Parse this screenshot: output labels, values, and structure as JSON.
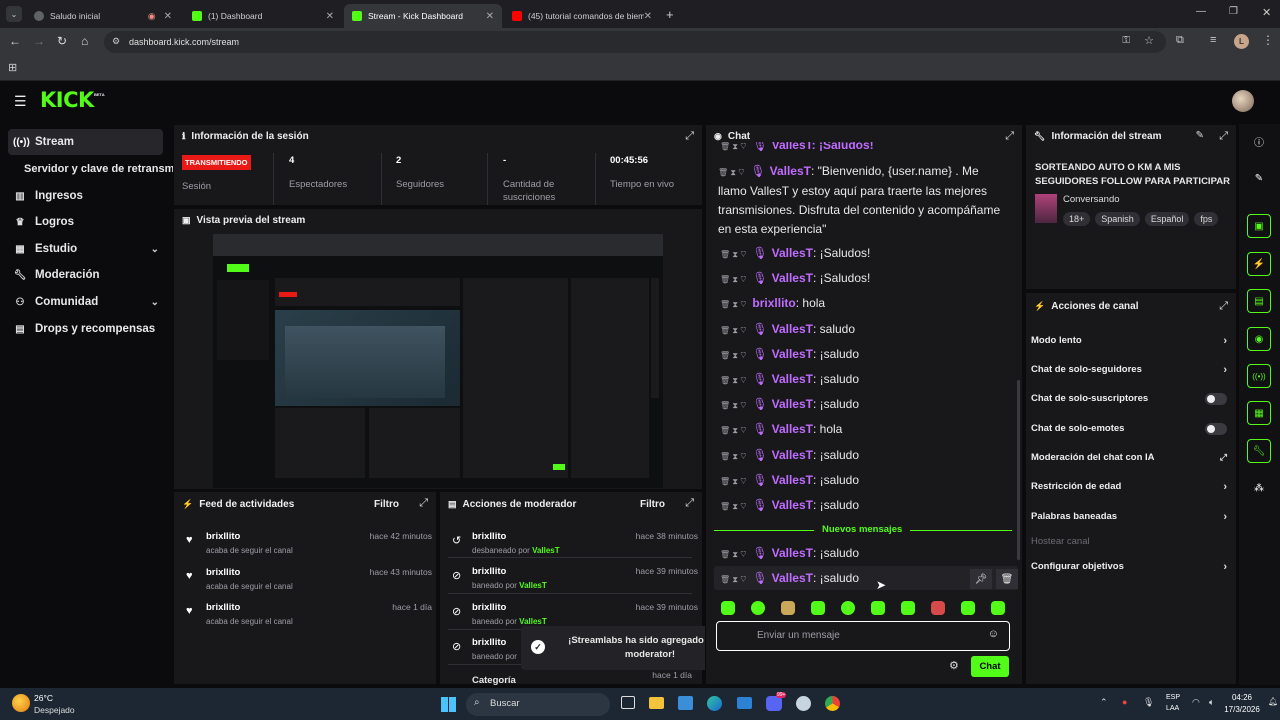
{
  "browser": {
    "tabs": [
      {
        "label": "Saludo inicial"
      },
      {
        "label": "(1) Dashboard"
      },
      {
        "label": "Stream - Kick Dashboard"
      },
      {
        "label": "(45) tutorial comandos de biem..."
      }
    ],
    "url": "dashboard.kick.com/stream",
    "profile_letter": "L"
  },
  "brand": {
    "logo": "KICK",
    "beta": "BETA"
  },
  "sidebar": {
    "items": [
      {
        "label": "Stream"
      },
      {
        "label": "Servidor y clave de retransm"
      },
      {
        "label": "Ingresos"
      },
      {
        "label": "Logros"
      },
      {
        "label": "Estudio"
      },
      {
        "label": "Moderación"
      },
      {
        "label": "Comunidad"
      },
      {
        "label": "Drops y recompensas"
      }
    ]
  },
  "session": {
    "title": "Información de la sesión",
    "status_badge": "TRANSMITIENDO",
    "status_label": "Sesión",
    "stats": [
      {
        "value": "4",
        "label": "Espectadores"
      },
      {
        "value": "2",
        "label": "Seguidores"
      },
      {
        "value": "-",
        "label": "Cantidad de suscriciones"
      },
      {
        "value": "00:45:56",
        "label": "Tiempo en vivo"
      }
    ]
  },
  "preview": {
    "title": "Vista previa del stream"
  },
  "feed": {
    "title": "Feed de actividades",
    "filter": "Filtro",
    "rows": [
      {
        "name": "brixllito",
        "sub": "acaba de seguir el canal",
        "time": "hace 42 minutos"
      },
      {
        "name": "brixllito",
        "sub": "acaba de seguir el canal",
        "time": "hace 43 minutos"
      },
      {
        "name": "brixllito",
        "sub": "acaba de seguir el canal",
        "time": "hace 1 día"
      }
    ]
  },
  "modactions": {
    "title": "Acciones de moderador",
    "filter": "Filtro",
    "rows": [
      {
        "name": "brixllito",
        "sub": "desbaneado por",
        "by": "VallesT",
        "time": "hace 38 minutos"
      },
      {
        "name": "brixllito",
        "sub": "baneado por",
        "by": "VallesT",
        "time": "hace 39 minutos"
      },
      {
        "name": "brixllito",
        "sub": "baneado por",
        "by": "VallesT",
        "time": "hace 39 minutos"
      },
      {
        "name": "brixllito",
        "sub": "baneado por",
        "by": "",
        "time": ""
      }
    ],
    "last_row": {
      "label": "Categoría",
      "time": "hace 1 día"
    }
  },
  "toast": {
    "text": "¡Streamlabs ha sido agregado como moderator!"
  },
  "chat": {
    "title": "Chat",
    "top_partial": "VallesT: ¡Saludos!",
    "welcome": {
      "user": "VallesT",
      "text": ": \"Bienvenido, {user.name} . Me llamo VallesT y estoy aquí para traerte las mejores transmisiones. Disfruta del contenido y acompáñame en esta experiencia\""
    },
    "messages": [
      {
        "user": "VallesT",
        "text": ": ¡Saludos!",
        "color": "#c06cff"
      },
      {
        "user": "VallesT",
        "text": ": ¡Saludos!",
        "color": "#c06cff"
      },
      {
        "user": "brixllito",
        "text": ": hola",
        "color": "#c06cff"
      },
      {
        "user": "VallesT",
        "text": ": saludo",
        "color": "#c06cff"
      },
      {
        "user": "VallesT",
        "text": ": ¡saludo",
        "color": "#c06cff"
      },
      {
        "user": "VallesT",
        "text": ": ¡saludo",
        "color": "#c06cff"
      },
      {
        "user": "VallesT",
        "text": ": ¡saludo",
        "color": "#c06cff"
      },
      {
        "user": "VallesT",
        "text": ": hola",
        "color": "#c06cff"
      },
      {
        "user": "VallesT",
        "text": ": ¡saludo",
        "color": "#c06cff"
      },
      {
        "user": "VallesT",
        "text": ": ¡saludo",
        "color": "#c06cff"
      },
      {
        "user": "VallesT",
        "text": ": ¡saludo",
        "color": "#c06cff"
      }
    ],
    "new_messages": "Nuevos mensajes",
    "after": [
      {
        "user": "VallesT",
        "text": ": ¡saludo"
      },
      {
        "user": "VallesT",
        "text": ": ¡saludo"
      }
    ],
    "input_placeholder": "Enviar un mensaje",
    "send_label": "Chat"
  },
  "streaminfo": {
    "title": "Información del stream",
    "stream_title": "SORTEANDO AUTO O KM A MIS SEGUIDORES FOLLOW PARA PARTICIPAR",
    "category": "Conversando",
    "tags": [
      "18+",
      "Spanish",
      "Español",
      "fps"
    ]
  },
  "channel_actions": {
    "title": "Acciones de canal",
    "items": [
      {
        "label": "Modo lento",
        "kind": "arrow"
      },
      {
        "label": "Chat de solo-seguidores",
        "kind": "arrow"
      },
      {
        "label": "Chat de solo-suscriptores",
        "kind": "toggle"
      },
      {
        "label": "Chat de solo-emotes",
        "kind": "toggle"
      },
      {
        "label": "Moderación del chat con IA",
        "kind": "external"
      },
      {
        "label": "Restricción de edad",
        "kind": "arrow"
      },
      {
        "label": "Palabras baneadas",
        "kind": "arrow"
      },
      {
        "label": "Hostear canal",
        "kind": "disabled"
      },
      {
        "label": "Configurar objetivos",
        "kind": "arrow"
      }
    ]
  },
  "taskbar": {
    "weather_temp": "26°C",
    "weather_desc": "Despejado",
    "search": "Buscar",
    "lang": "ESP",
    "lang2": "LAA",
    "time": "04:26",
    "date": "17/3/2026",
    "badge_count": "99+"
  },
  "colors": {
    "accent": "#53fc18",
    "live": "#e91916",
    "panel": "#18181b"
  }
}
